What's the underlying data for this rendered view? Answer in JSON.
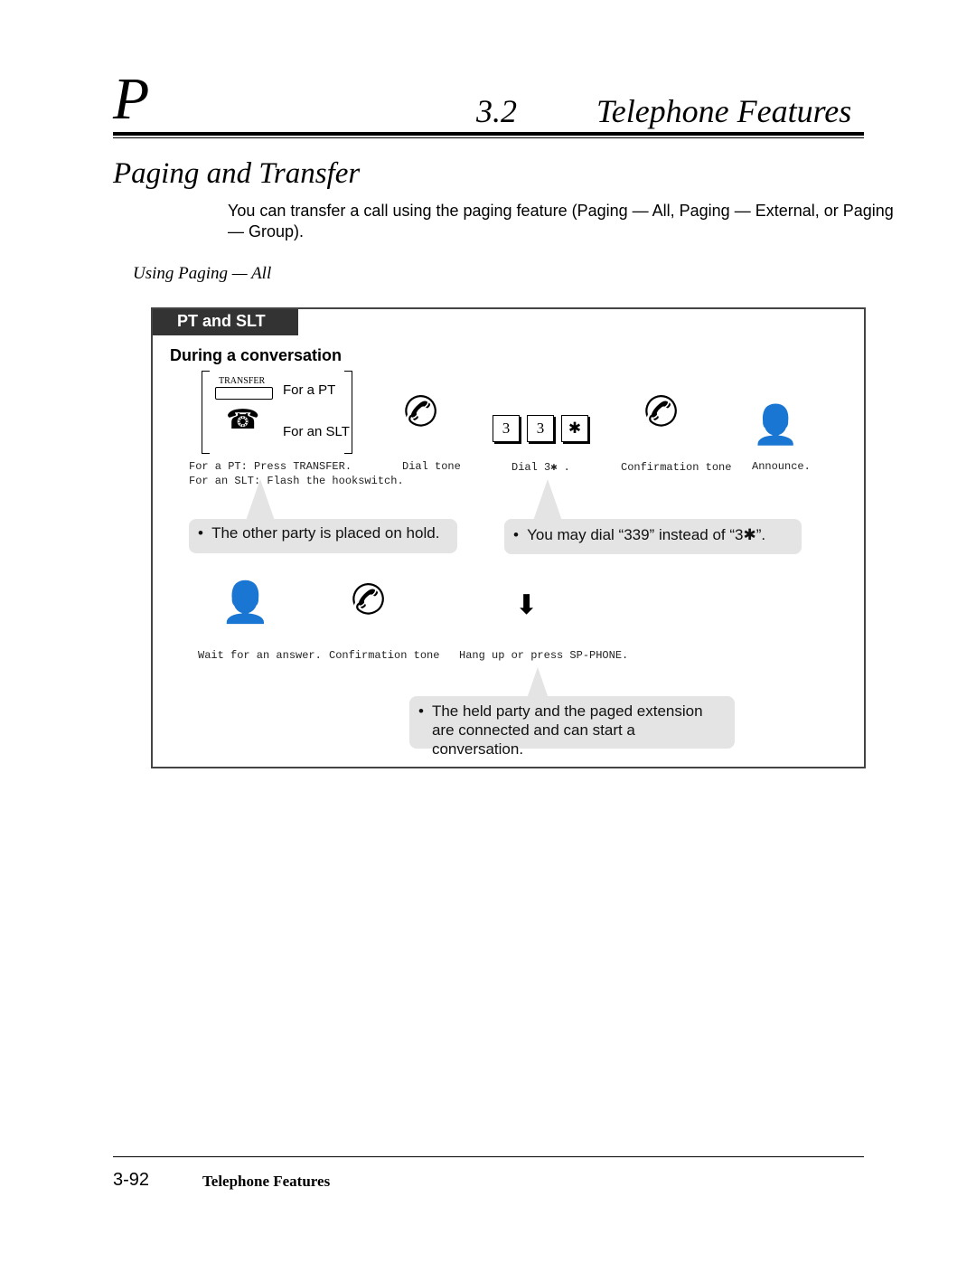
{
  "header": {
    "letter": "P",
    "section_number": "3.2",
    "section_title": "Telephone Features"
  },
  "title": "Paging and Transfer",
  "intro": "You can transfer a call using the paging feature (Paging — All, Paging — External, or Paging — Group).",
  "subheading": "Using Paging — All",
  "box": {
    "tab_label": "PT and SLT",
    "heading": "During a conversation",
    "transfer_key_label": "TRANSFER",
    "for_pt": "For a PT",
    "for_slt": "For an SLT",
    "step1_line1": "For a PT: Press TRANSFER.",
    "step1_line2": "For an SLT: Flash the hookswitch.",
    "step2": "Dial tone",
    "keys": [
      "3",
      "3",
      "✱"
    ],
    "step3": "Dial 3✱ .",
    "step4": "Confirmation tone",
    "step5": "Announce.",
    "note1": "The other party is placed on hold.",
    "note2": "You may dial “339” instead of “3✱”.",
    "step6": "Wait for an answer.",
    "step7": "Confirmation tone",
    "step8": "Hang up or press SP-PHONE.",
    "note3": "The held party and the paged extension are connected and can start a conversation."
  },
  "footer": {
    "page": "3-92",
    "title": "Telephone Features"
  }
}
